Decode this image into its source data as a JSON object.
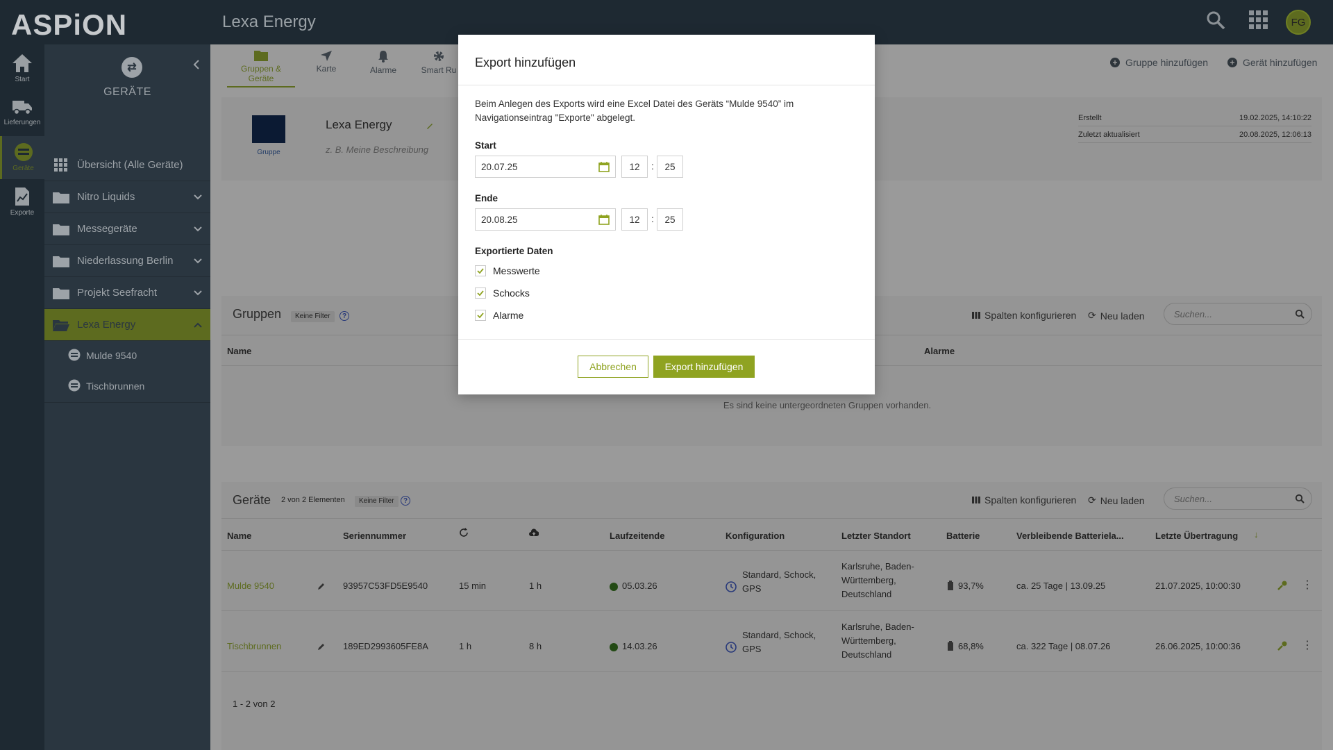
{
  "app": {
    "logo": "ASPiON",
    "title": "Lexa Energy",
    "avatar_initials": "FG"
  },
  "rail": [
    {
      "label": "Start",
      "icon": "home-icon"
    },
    {
      "label": "Lieferungen",
      "icon": "truck-icon"
    },
    {
      "label": "Geräte",
      "icon": "device-icon"
    },
    {
      "label": "Exporte",
      "icon": "export-icon"
    }
  ],
  "sidenav": {
    "title": "GERÄTE",
    "overview": "Übersicht (Alle Geräte)",
    "folders": [
      "Nitro Liquids",
      "Messegeräte",
      "Niederlassung Berlin",
      "Projekt Seefracht",
      "Lexa Energy"
    ],
    "sub_items": [
      "Mulde 9540",
      "Tischbrunnen"
    ]
  },
  "tabs": [
    "Gruppen & Geräte",
    "Karte",
    "Alarme",
    "Smart Ru"
  ],
  "header_actions": {
    "add_group": "Gruppe hinzufügen",
    "add_device": "Gerät hinzufügen"
  },
  "info": {
    "name": "Lexa Energy",
    "icon_label": "Gruppe",
    "description": "z. B. Meine Beschreibung",
    "meta": [
      {
        "label": "Erstellt",
        "value": "19.02.2025, 14:10:22"
      },
      {
        "label": "Zuletzt aktualisiert",
        "value": "20.08.2025, 12:06:13"
      }
    ]
  },
  "groups_section": {
    "title": "Gruppen",
    "filter_chip": "Keine Filter",
    "configure": "Spalten konfigurieren",
    "reload": "Neu laden",
    "search_placeholder": "Suchen...",
    "col_name": "Name",
    "col_alarms": "Alarme",
    "empty_text": "Es sind keine untergeordneten Gruppen vorhanden."
  },
  "devices_section": {
    "title": "Geräte",
    "count": "2 von 2 Elementen",
    "filter_chip": "Keine Filter",
    "configure": "Spalten konfigurieren",
    "reload": "Neu laden",
    "search_placeholder": "Suchen...",
    "columns": [
      "Name",
      "Seriennummer",
      "Laufzeitende",
      "Konfiguration",
      "Letzter Standort",
      "Batterie",
      "Verbleibende Batteriela...",
      "Letzte Übertragung"
    ],
    "rows": [
      {
        "name": "Mulde 9540",
        "serial": "93957C53FD5E9540",
        "interval": "15 min",
        "upload": "1 h",
        "end": "05.03.26",
        "config": "Standard, Schock, GPS",
        "location": "Karlsruhe, Baden-Württemberg, Deutschland",
        "battery": "93,7%",
        "remaining": "ca. 25 Tage | 13.09.25",
        "last": "21.07.2025, 10:00:30"
      },
      {
        "name": "Tischbrunnen",
        "serial": "189ED2993605FE8A",
        "interval": "1 h",
        "upload": "8 h",
        "end": "14.03.26",
        "config": "Standard, Schock, GPS",
        "location": "Karlsruhe, Baden-Württemberg, Deutschland",
        "battery": "68,8%",
        "remaining": "ca. 322 Tage | 08.07.26",
        "last": "26.06.2025, 10:00:36"
      }
    ],
    "pagination": "1 - 2 von 2"
  },
  "modal": {
    "title": "Export hinzufügen",
    "description": "Beim Anlegen des Exports wird eine Excel Datei des Geräts “Mulde 9540” im Navigationseintrag \"Exporte\" abgelegt.",
    "start_label": "Start",
    "start_date": "20.07.25",
    "start_hour": "12",
    "start_min": "25",
    "end_label": "Ende",
    "end_date": "20.08.25",
    "end_hour": "12",
    "end_min": "25",
    "exported_label": "Exportierte Daten",
    "options": [
      "Messwerte",
      "Schocks",
      "Alarme"
    ],
    "cancel": "Abbrechen",
    "submit": "Export hinzufügen"
  },
  "colors": {
    "accent": "#8fa321",
    "accent_dim": "#5d6b1f",
    "dark": "#1e2932",
    "overlay": "#9a9a9a"
  }
}
